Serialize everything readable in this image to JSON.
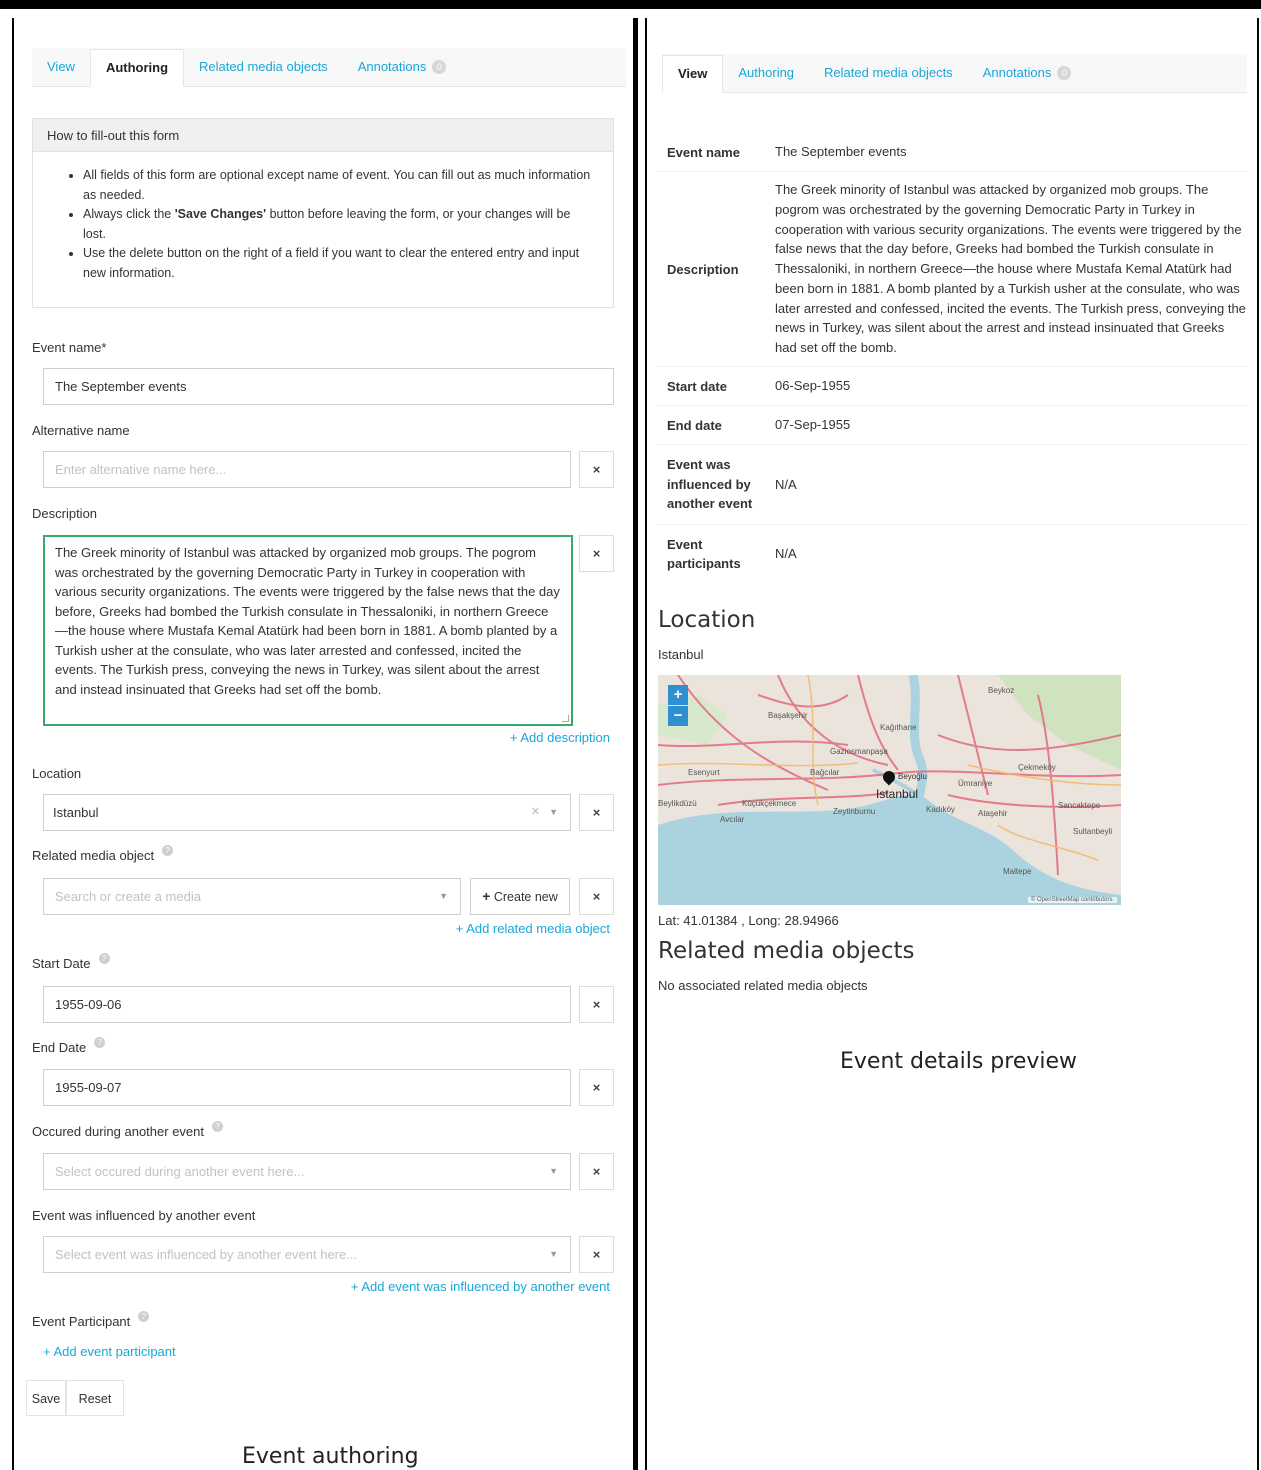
{
  "left": {
    "tabs": [
      {
        "label": "View"
      },
      {
        "label": "Authoring"
      },
      {
        "label": "Related media objects"
      },
      {
        "label": "Annotations",
        "badge": "0"
      }
    ],
    "help": {
      "title": "How to fill-out this form",
      "items": [
        "All fields of this form are optional except name of event. You can fill out as much information as needed.",
        "Always click the 'Save Changes' button before leaving the form, or your changes will be lost.",
        "Use the delete button on the right of a field if you want to clear the entered entry and input new information."
      ]
    },
    "fields": {
      "event_name_label": "Event name*",
      "event_name_value": "The September events",
      "alt_name_label": "Alternative name",
      "alt_name_placeholder": "Enter alternative name here...",
      "description_label": "Description",
      "description_value": "The Greek minority of Istanbul was attacked by organized mob groups. The pogrom was orchestrated by the governing Democratic Party in Turkey in cooperation with various security organizations. The events were triggered by the false news that the day before, Greeks had bombed the Turkish consulate in Thessaloniki, in northern Greece—the house where Mustafa Kemal Atatürk had been born in 1881. A bomb planted by a Turkish usher at the consulate, who was later arrested and confessed, incited the events. The Turkish press, conveying the news in Turkey, was silent about the arrest and instead insinuated that Greeks had set off the bomb.",
      "add_description": "+ Add description",
      "location_label": "Location",
      "location_value": "Istanbul",
      "media_label": "Related media object",
      "media_placeholder": "Search or create a media",
      "create_new": "Create new",
      "add_media": "+ Add related media object",
      "start_label": "Start Date",
      "start_value": "1955-09-06",
      "end_label": "End Date",
      "end_value": "1955-09-07",
      "during_label": "Occured during another event",
      "during_placeholder": "Select occured during another event here...",
      "influenced_label": "Event was influenced by another event",
      "influenced_placeholder": "Select event was influenced by another event here...",
      "add_influenced": "+ Add event was influenced by another event",
      "participant_label": "Event Participant",
      "add_participant": "+ Add event participant"
    },
    "buttons": {
      "save": "Save",
      "reset": "Reset",
      "clear": "×"
    },
    "caption": "Event authoring"
  },
  "right": {
    "tabs": [
      {
        "label": "View"
      },
      {
        "label": "Authoring"
      },
      {
        "label": "Related media objects"
      },
      {
        "label": "Annotations",
        "badge": "0"
      }
    ],
    "details": {
      "event_name_label": "Event name",
      "event_name_value": "The September events",
      "description_label": "Description",
      "description_value": "The Greek minority of Istanbul was attacked by organized mob groups. The pogrom was orchestrated by the governing Democratic Party in Turkey in cooperation with various security organizations. The events were triggered by the false news that the day before, Greeks had bombed the Turkish consulate in Thessaloniki, in northern Greece—the house where Mustafa Kemal Atatürk had been born in 1881. A bomb planted by a Turkish usher at the consulate, who was later arrested and confessed, incited the events. The Turkish press, conveying the news in Turkey, was silent about the arrest and instead insinuated that Greeks had set off the bomb.",
      "start_label": "Start date",
      "start_value": "06-Sep-1955",
      "end_label": "End date",
      "end_value": "07-Sep-1955",
      "influenced_label": "Event was influenced by another event",
      "influenced_value": "N/A",
      "participants_label": "Event participants",
      "participants_value": "N/A"
    },
    "location_heading": "Location",
    "location_name": "Istanbul",
    "map": {
      "zoom_in": "+",
      "zoom_out": "−",
      "places": [
        "Beykoz",
        "Başakşehir",
        "Kağıthane",
        "Gaziosmanpaşa",
        "Esenyurt",
        "Bağcılar",
        "Beyoğlu",
        "Ümraniye",
        "Çekmeköy",
        "Istanbul",
        "Beylikdüzü",
        "Küçükçekmece",
        "Zeytinburnu",
        "Kadıköy",
        "Ataşehir",
        "Sancaktepe",
        "Avcılar",
        "Sultanbeyli",
        "Maltepe"
      ],
      "attribution": "© OpenStreetMap contributors."
    },
    "coords": "Lat: 41.01384 , Long: 28.94966",
    "media_heading": "Related media objects",
    "media_none": "No associated related media objects",
    "caption": "Event details preview"
  }
}
